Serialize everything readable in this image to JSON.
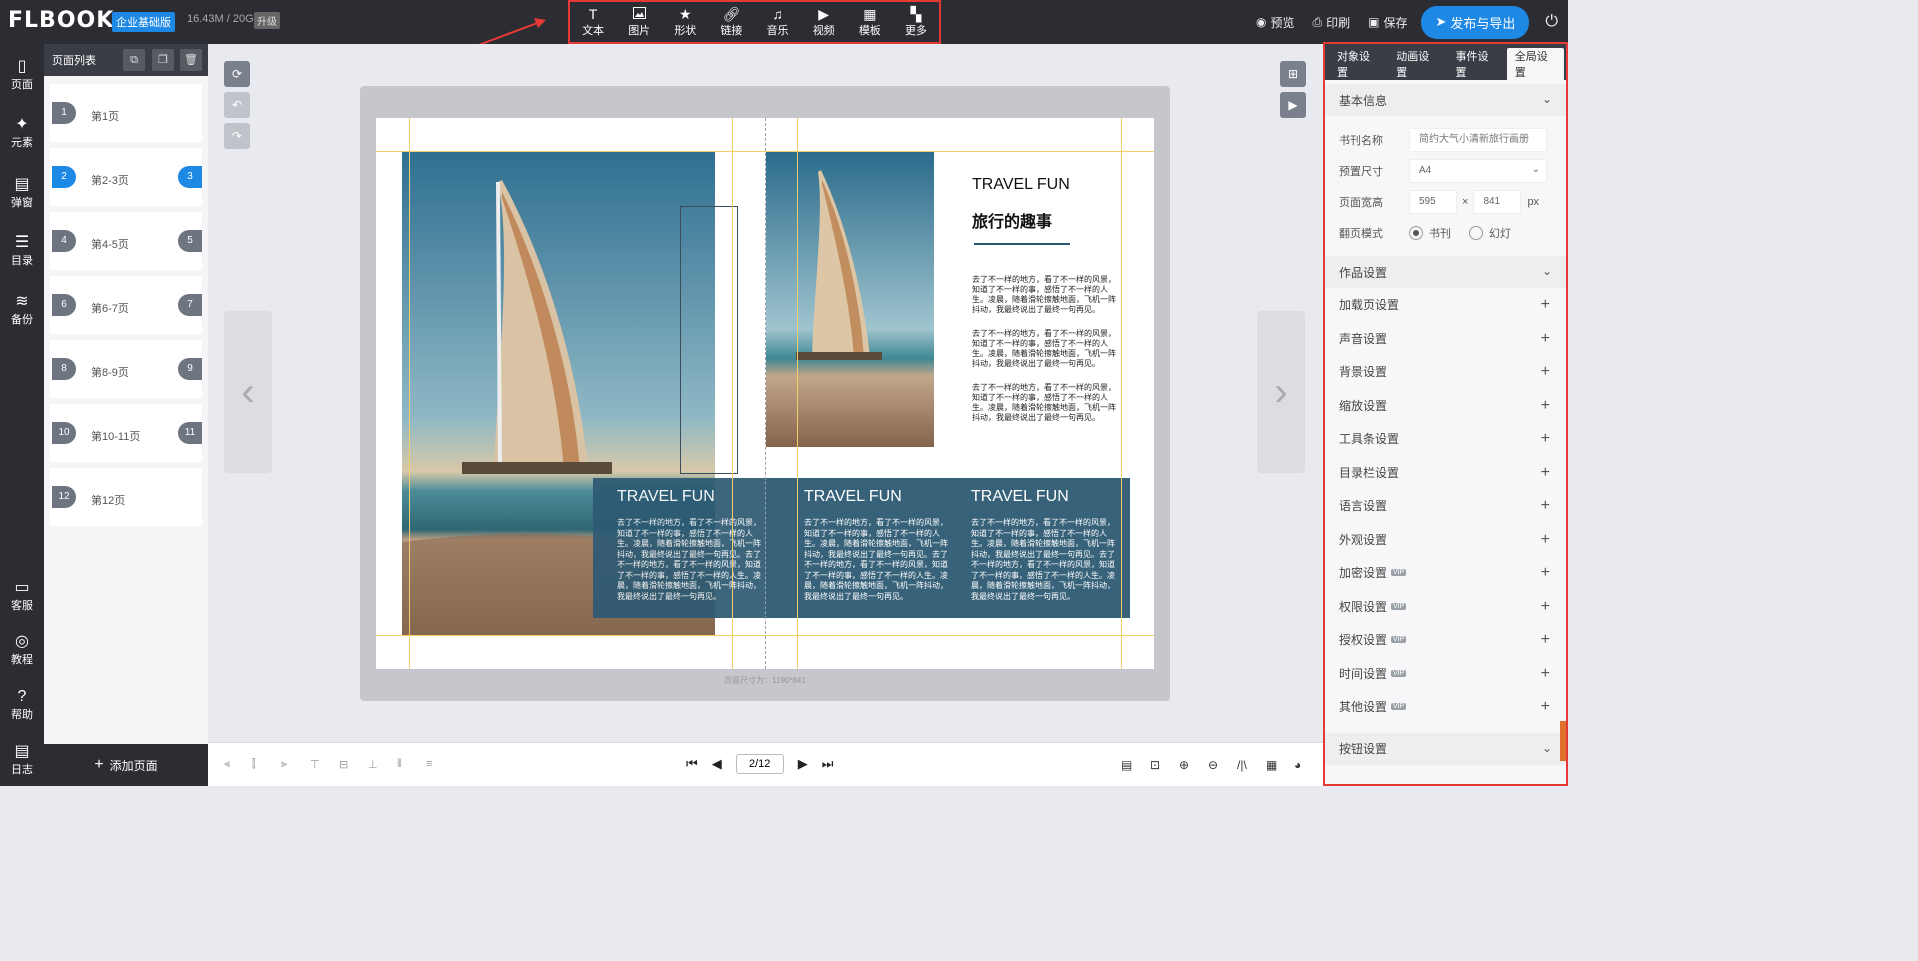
{
  "topbar": {
    "logo": "FLBOOK",
    "logo_mark": "®",
    "edition": "企业基础版",
    "storage": "16.43M / 20G",
    "upgrade": "升级",
    "tools": [
      {
        "icon": "text-icon",
        "label": "文本"
      },
      {
        "icon": "image-icon",
        "label": "图片"
      },
      {
        "icon": "shape-icon",
        "label": "形状"
      },
      {
        "icon": "link-icon",
        "label": "链接"
      },
      {
        "icon": "music-icon",
        "label": "音乐"
      },
      {
        "icon": "video-icon",
        "label": "视频"
      },
      {
        "icon": "template-icon",
        "label": "模板"
      },
      {
        "icon": "more-icon",
        "label": "更多"
      }
    ],
    "preview": "预览",
    "print": "印刷",
    "save": "保存",
    "publish": "发布与导出"
  },
  "rail": {
    "top": [
      {
        "icon": "page-icon",
        "label": "页面"
      },
      {
        "icon": "element-icon",
        "label": "元素"
      },
      {
        "icon": "popup-icon",
        "label": "弹窗"
      },
      {
        "icon": "catalog-icon",
        "label": "目录"
      },
      {
        "icon": "backup-icon",
        "label": "备份"
      }
    ],
    "bottom": [
      {
        "icon": "service-icon",
        "label": "客服"
      },
      {
        "icon": "tutorial-icon",
        "label": "教程"
      },
      {
        "icon": "help-icon",
        "label": "帮助"
      },
      {
        "icon": "log-icon",
        "label": "日志"
      }
    ]
  },
  "pagelist": {
    "title": "页面列表",
    "items": [
      {
        "num": "1",
        "label": "第1页",
        "num2": "",
        "active": false
      },
      {
        "num": "2",
        "label": "第2-3页",
        "num2": "3",
        "active": true
      },
      {
        "num": "4",
        "label": "第4-5页",
        "num2": "5",
        "active": false
      },
      {
        "num": "6",
        "label": "第6-7页",
        "num2": "7",
        "active": false
      },
      {
        "num": "8",
        "label": "第8-9页",
        "num2": "9",
        "active": false
      },
      {
        "num": "10",
        "label": "第10-11页",
        "num2": "11",
        "active": false
      },
      {
        "num": "12",
        "label": "第12页",
        "num2": "",
        "active": false
      }
    ],
    "add_page": "添加页面"
  },
  "canvas": {
    "page_size": "页面尺寸为：1190*841",
    "heading1": "TRAVEL FUN",
    "heading_cn": "旅行的趣事",
    "paragraph": "去了不一样的地方，看了不一样的风景，知道了不一样的事，感悟了不一样的人生。凌晨，随着滑轮擦触地面，飞机一阵抖动，我最终说出了最终一句再见。",
    "box_title": "TRAVEL FUN",
    "box_paragraph": "去了不一样的地方，看了不一样的风景，知道了不一样的事，感悟了不一样的人生。凌晨，随着滑轮擦触地面，飞机一阵抖动，我最终说出了最终一句再见。去了不一样的地方，看了不一样的风景，知道了不一样的事，感悟了不一样的人生。凌晨，随着滑轮擦触地面，飞机一阵抖动，我最终说出了最终一句再见。"
  },
  "bottombar": {
    "page_indicator": "2/12"
  },
  "rightpanel": {
    "tabs": [
      "对象设置",
      "动画设置",
      "事件设置",
      "全局设置"
    ],
    "active_tab": 3,
    "basic_info": "基本信息",
    "book_name_label": "书刊名称",
    "book_name_placeholder": "简约大气小清新旅行画册",
    "preset_size_label": "预置尺寸",
    "preset_size_value": "A4",
    "page_width_label": "页面宽高",
    "page_width": "595",
    "page_height": "841",
    "px": "px",
    "times": "×",
    "flip_mode_label": "翻页模式",
    "flip_book": "书刊",
    "flip_slide": "幻灯",
    "work_settings": "作品设置",
    "settings": [
      {
        "label": "加载页设置",
        "vip": false
      },
      {
        "label": "声音设置",
        "vip": false
      },
      {
        "label": "背景设置",
        "vip": false
      },
      {
        "label": "缩放设置",
        "vip": false
      },
      {
        "label": "工具条设置",
        "vip": false
      },
      {
        "label": "目录栏设置",
        "vip": false
      },
      {
        "label": "语言设置",
        "vip": false
      },
      {
        "label": "外观设置",
        "vip": false
      },
      {
        "label": "加密设置",
        "vip": true
      },
      {
        "label": "权限设置",
        "vip": true
      },
      {
        "label": "授权设置",
        "vip": true
      },
      {
        "label": "时间设置",
        "vip": true
      },
      {
        "label": "其他设置",
        "vip": true
      }
    ],
    "vip_label": "VIP",
    "button_settings": "按钮设置"
  },
  "colors": {
    "accent": "#1e88e5",
    "dark": "#2b2d33",
    "highlight": "#e53935",
    "box": "#2d5a73",
    "guide": "#f2cd6a"
  }
}
